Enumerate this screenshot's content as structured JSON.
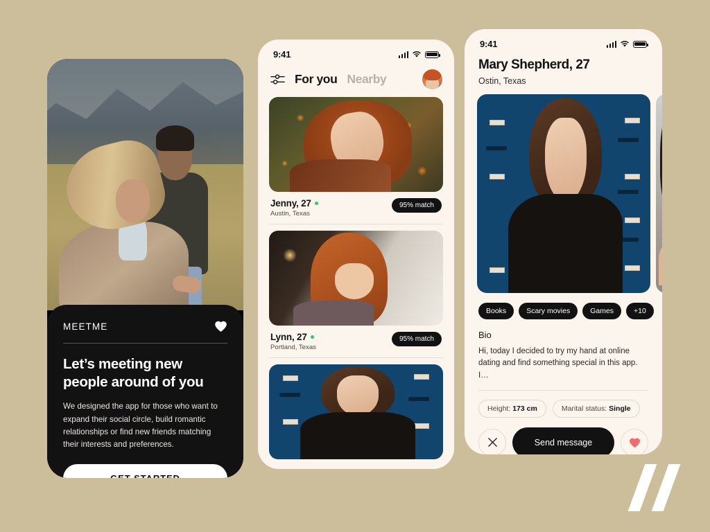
{
  "canvas": {
    "background_color": "#ccbd9b",
    "logo_mark": "double-slash-logo"
  },
  "onboarding": {
    "brand": "MEETME",
    "heart_icon": "heart-icon",
    "title": "Let’s meeting new people around of you",
    "description": "We designed the app for those who want to expand their social circle, build romantic relationships or find new friends matching their interests and preferences.",
    "cta_label": "GET STARTED",
    "photo_alt": "couple-running-in-field-photo"
  },
  "feed": {
    "status_bar": {
      "time": "9:41",
      "signal_icon": "cellular-signal-icon",
      "wifi_icon": "wifi-icon",
      "battery_icon": "battery-full-icon"
    },
    "filter_icon": "filter-sliders-icon",
    "avatar": "user-avatar",
    "tabs": [
      {
        "label": "For you",
        "active": true
      },
      {
        "label": "Nearby",
        "active": false
      }
    ],
    "cards": [
      {
        "name": "Jenny, 27",
        "location": "Austin, Texas",
        "match": "95% match",
        "online": true,
        "photo": "woman-in-flowers-photo"
      },
      {
        "name": "Lynn, 27",
        "location": "Portland, Texas",
        "match": "95% match",
        "online": true,
        "photo": "woman-laughing-indoors-photo"
      },
      {
        "name": "",
        "location": "",
        "match": "",
        "online": false,
        "photo": "woman-at-blue-lockers-photo"
      }
    ]
  },
  "profile": {
    "status_bar": {
      "time": "9:41",
      "signal_icon": "cellular-signal-icon",
      "wifi_icon": "wifi-icon",
      "battery_icon": "battery-full-icon"
    },
    "name": "Mary Shepherd, 27",
    "location": "Ostin, Texas",
    "photo": "woman-at-blue-lockers-photo",
    "photo_next": "second-gallery-photo",
    "tags": [
      "Books",
      "Scary movies",
      "Games",
      "+10"
    ],
    "bio_title": "Bio",
    "bio_text": "Hi, today I decided to try my hand at online dating and find something special in this app. I…",
    "facts": [
      {
        "label": "Height:",
        "value": "173 cm"
      },
      {
        "label": "Marital status:",
        "value": "Single"
      }
    ],
    "actions": {
      "dismiss_icon": "close-x-icon",
      "send_label": "Send message",
      "like_icon": "heart-icon"
    }
  }
}
